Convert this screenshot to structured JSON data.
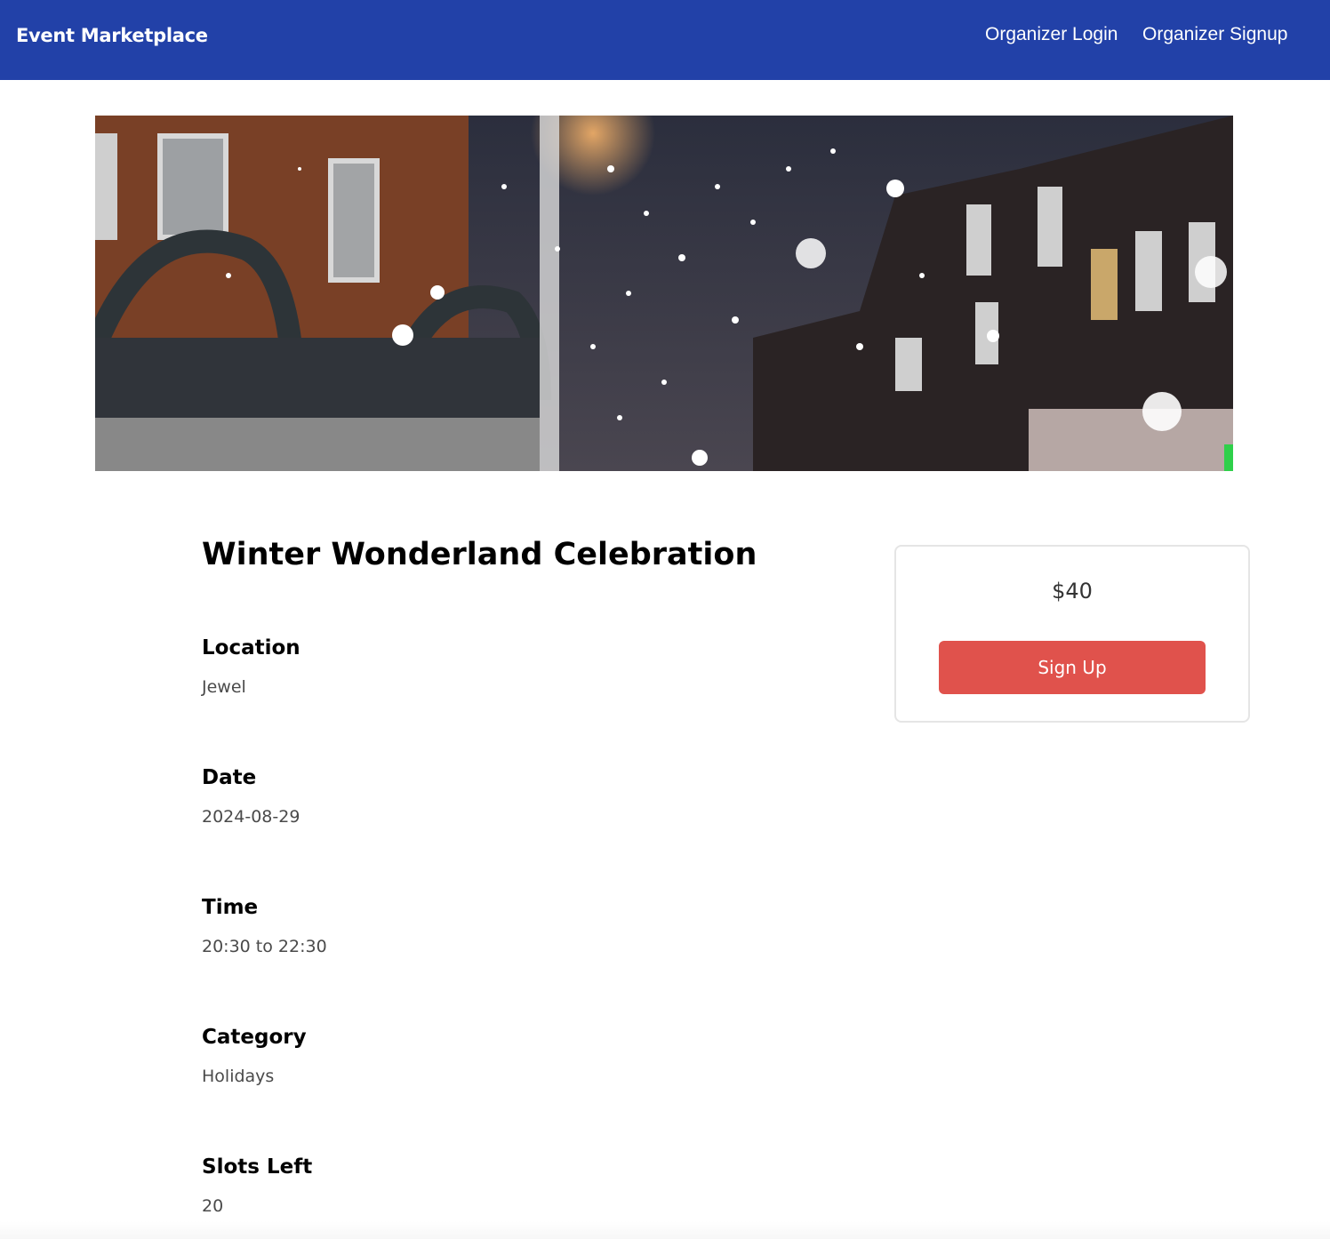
{
  "navbar": {
    "brand": "Event Marketplace",
    "links": [
      {
        "label": "Organizer Login"
      },
      {
        "label": "Organizer Signup"
      }
    ],
    "bg_color": "#2241a8"
  },
  "hero": {
    "image": "snowy-night-street-photo"
  },
  "event": {
    "title": "Winter Wonderland Celebration",
    "details": [
      {
        "label": "Location",
        "value": "Jewel"
      },
      {
        "label": "Date",
        "value": "2024-08-29"
      },
      {
        "label": "Time",
        "value": "20:30 to 22:30"
      },
      {
        "label": "Category",
        "value": "Holidays"
      },
      {
        "label": "Slots Left",
        "value": "20"
      }
    ]
  },
  "purchase": {
    "price": "$40",
    "button_label": "Sign Up",
    "button_color": "#e0524c"
  }
}
